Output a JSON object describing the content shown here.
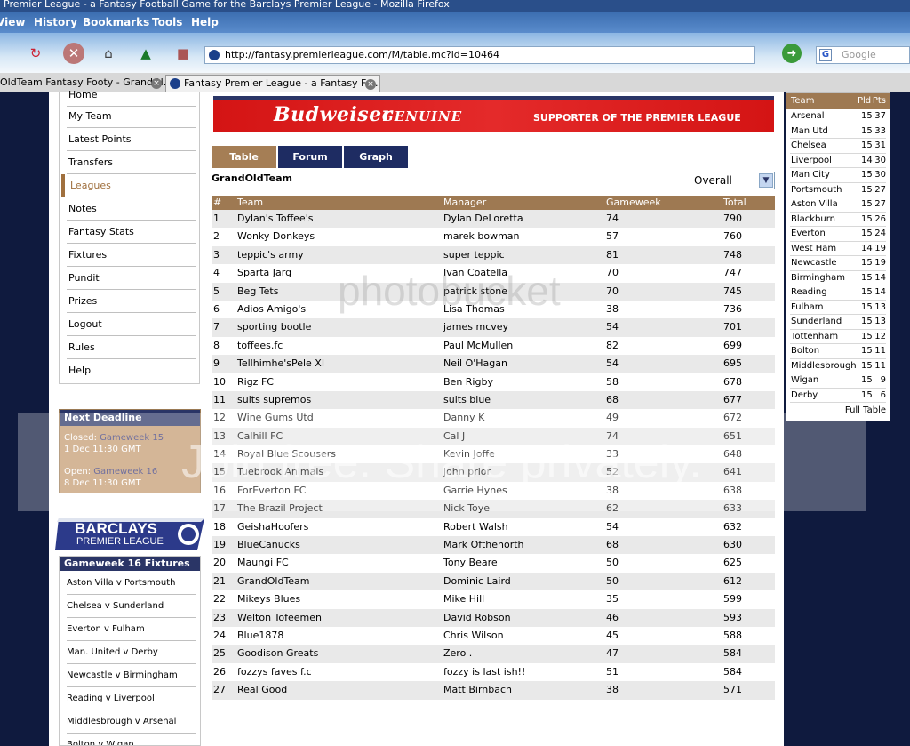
{
  "window": {
    "title": "Premier League - a Fantasy Football Game for the Barclays Premier League - Mozilla Firefox"
  },
  "menu": [
    "View",
    "History",
    "Bookmarks",
    "Tools",
    "Help"
  ],
  "address": {
    "url": "http://fantasy.premierleague.com/M/table.mc?id=10464"
  },
  "search": {
    "placeholder": "Google"
  },
  "tabs": [
    {
      "label": "OldTeam Fantasy Footy - GrandOl..."
    },
    {
      "label": "Fantasy Premier League - a Fantasy Fo..."
    }
  ],
  "leftnav": [
    "Home",
    "My Team",
    "Latest Points",
    "Transfers",
    "Leagues",
    "Notes",
    "Fantasy Stats",
    "Fixtures",
    "Pundit",
    "Prizes",
    "Logout",
    "Rules",
    "Help"
  ],
  "leftnav_active": "Leagues",
  "deadline": {
    "title": "Next Deadline",
    "closed_label": "Closed:",
    "closed_gw": "Gameweek 15",
    "closed_date": "1 Dec 11:30 GMT",
    "open_label": "Open:",
    "open_gw": "Gameweek 16",
    "open_date": "8 Dec 11:30 GMT"
  },
  "sponsor": {
    "line1": "BARCLAYS",
    "line2": "PREMIER LEAGUE"
  },
  "fixtures": {
    "title": "Gameweek 16 Fixtures",
    "items": [
      "Aston Villa v Portsmouth",
      "Chelsea v Sunderland",
      "Everton v Fulham",
      "Man. United v Derby",
      "Newcastle v Birmingham",
      "Reading v Liverpool",
      "Middlesbrough v Arsenal",
      "Bolton v Wigan"
    ]
  },
  "banner": {
    "brand": "Budweiser",
    "tag": "GENUINE",
    "supporter": "SUPPORTER OF THE PREMIER LEAGUE"
  },
  "page_tabs": [
    "Table",
    "Forum",
    "Graph"
  ],
  "league": {
    "name": "GrandOldTeam",
    "filter": "Overall",
    "columns": [
      "#",
      "Team",
      "Manager",
      "Gameweek",
      "Total"
    ],
    "rows": [
      [
        "1",
        "Dylan's Toffee's",
        "Dylan DeLoretta",
        "74",
        "790"
      ],
      [
        "2",
        "Wonky Donkeys",
        "marek bowman",
        "57",
        "760"
      ],
      [
        "3",
        "teppic's army",
        "super teppic",
        "81",
        "748"
      ],
      [
        "4",
        "Sparta Jarg",
        "Ivan Coatella",
        "70",
        "747"
      ],
      [
        "5",
        "Beg Tets",
        "patrick stone",
        "70",
        "745"
      ],
      [
        "6",
        "Adios Amigo's",
        "Lisa Thomas",
        "38",
        "736"
      ],
      [
        "7",
        "sporting bootle",
        "james mcvey",
        "54",
        "701"
      ],
      [
        "8",
        "toffees.fc",
        "Paul McMullen",
        "82",
        "699"
      ],
      [
        "9",
        "Tellhimhe'sPele XI",
        "Neil O'Hagan",
        "54",
        "695"
      ],
      [
        "10",
        "Rigz FC",
        "Ben Rigby",
        "58",
        "678"
      ],
      [
        "11",
        "suits supremos",
        "suits blue",
        "68",
        "677"
      ],
      [
        "12",
        "Wine Gums Utd",
        "Danny K",
        "49",
        "672"
      ],
      [
        "13",
        "Calhill FC",
        "Cal J",
        "74",
        "651"
      ],
      [
        "14",
        "Royal Blue Scousers",
        "Kevin Joffe",
        "33",
        "648"
      ],
      [
        "15",
        "Tuebrook Animals",
        "john prior",
        "52",
        "641"
      ],
      [
        "16",
        "ForEverton FC",
        "Garrie Hynes",
        "38",
        "638"
      ],
      [
        "17",
        "The Brazil Project",
        "Nick Toye",
        "62",
        "633"
      ],
      [
        "18",
        "GeishaHoofers",
        "Robert Walsh",
        "54",
        "632"
      ],
      [
        "19",
        "BlueCanucks",
        "Mark Ofthenorth",
        "68",
        "630"
      ],
      [
        "20",
        "Maungi FC",
        "Tony Beare",
        "50",
        "625"
      ],
      [
        "21",
        "GrandOldTeam",
        "Dominic Laird",
        "50",
        "612"
      ],
      [
        "22",
        "Mikeys Blues",
        "Mike Hill",
        "35",
        "599"
      ],
      [
        "23",
        "Welton Tofeemen",
        "David Robson",
        "46",
        "593"
      ],
      [
        "24",
        "Blue1878",
        "Chris Wilson",
        "45",
        "588"
      ],
      [
        "25",
        "Goodison Greats",
        "Zero .",
        "47",
        "584"
      ],
      [
        "26",
        "fozzys faves f.c",
        "fozzy is last ish!!",
        "51",
        "584"
      ],
      [
        "27",
        "Real Good",
        "Matt Birnbach",
        "38",
        "571"
      ]
    ]
  },
  "pl_table": {
    "columns": [
      "Team",
      "Pld",
      "Pts"
    ],
    "rows": [
      [
        "Arsenal",
        "15",
        "37"
      ],
      [
        "Man Utd",
        "15",
        "33"
      ],
      [
        "Chelsea",
        "15",
        "31"
      ],
      [
        "Liverpool",
        "14",
        "30"
      ],
      [
        "Man City",
        "15",
        "30"
      ],
      [
        "Portsmouth",
        "15",
        "27"
      ],
      [
        "Aston Villa",
        "15",
        "27"
      ],
      [
        "Blackburn",
        "15",
        "26"
      ],
      [
        "Everton",
        "15",
        "24"
      ],
      [
        "West Ham",
        "14",
        "19"
      ],
      [
        "Newcastle",
        "15",
        "19"
      ],
      [
        "Birmingham",
        "15",
        "14"
      ],
      [
        "Reading",
        "15",
        "14"
      ],
      [
        "Fulham",
        "15",
        "13"
      ],
      [
        "Sunderland",
        "15",
        "13"
      ],
      [
        "Tottenham",
        "15",
        "12"
      ],
      [
        "Bolton",
        "15",
        "11"
      ],
      [
        "Middlesbrough",
        "15",
        "11"
      ],
      [
        "Wigan",
        "15",
        "9"
      ],
      [
        "Derby",
        "15",
        "6"
      ]
    ],
    "full_link": "Full Table"
  },
  "watermark": {
    "text": "Join free. Share privately.",
    "logo": "photobucket"
  },
  "colors": {
    "nav_dark": "#2a3566",
    "accent_brown": "#9e7952",
    "banner_red": "#d41414",
    "page_bg": "#0f1a3e"
  }
}
